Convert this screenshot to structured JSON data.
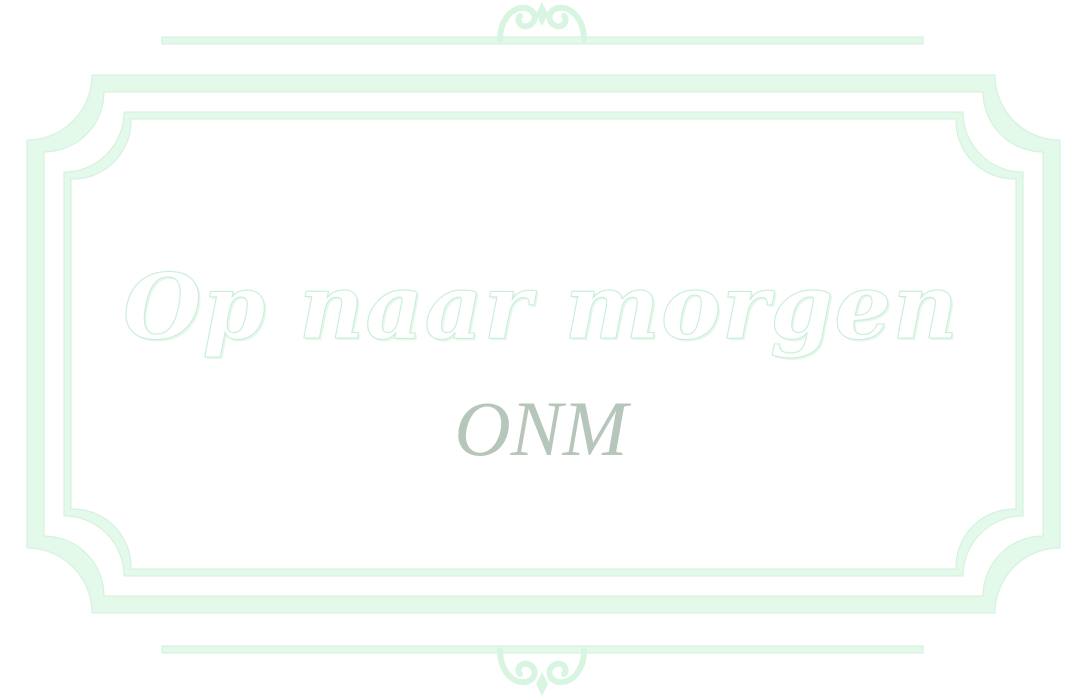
{
  "sign": {
    "title": "Op naar morgen",
    "subtitle": "ONM"
  },
  "colors": {
    "frame": "#e3f9ea",
    "frame_edge": "#d2f0dc",
    "title_outline": "#c8edd6",
    "subtitle": "#b6c6bb",
    "background": "#ffffff"
  },
  "icons": {
    "top_ornament": "scroll-flourish-icon",
    "bottom_ornament": "scroll-flourish-icon"
  }
}
